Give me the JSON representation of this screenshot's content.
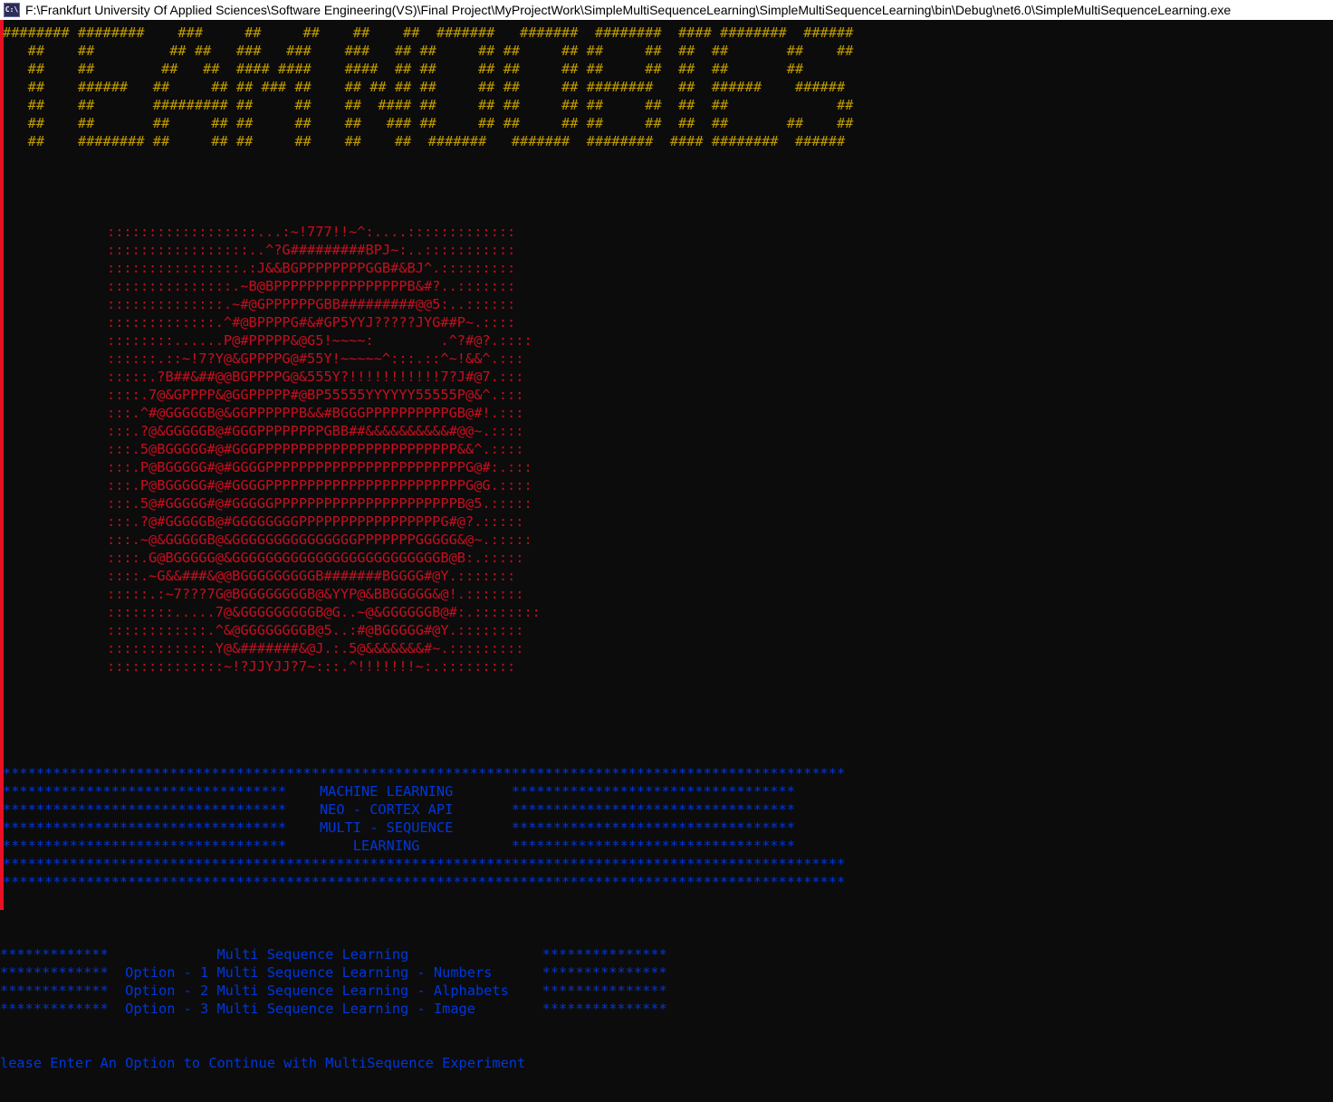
{
  "window": {
    "title": "F:\\Frankfurt University Of Applied Sciences\\Software Engineering(VS)\\Final Project\\MyProjectWork\\SimpleMultiSequenceLearning\\SimpleMultiSequenceLearning\\bin\\Debug\\net6.0\\SimpleMultiSequenceLearning.exe",
    "icon": "console-app-icon",
    "icon_glyph": "C:\\"
  },
  "colors": {
    "background": "#0c0c0c",
    "banner": "#c19c00",
    "art": "#c50f1f",
    "ml_box": "#0037da",
    "menu": "#0037da",
    "prompt": "#0037da",
    "red_bar": "#e81123"
  },
  "console": {
    "banner": "######## ########    ###     ##     ##    ##    ##  #######   #######  ########  #### ########  ######\n   ##    ##         ## ##   ###   ###    ###   ## ##     ## ##     ## ##     ##  ##  ##       ##    ##\n   ##    ##        ##   ##  #### ####    ####  ## ##     ## ##     ## ##     ##  ##  ##       ##\n   ##    ######   ##     ## ## ### ##    ## ## ## ##     ## ##     ## ########   ##  ######    ######\n   ##    ##       ######### ##     ##    ##  #### ##     ## ##     ## ##     ##  ##  ##             ##\n   ##    ##       ##     ## ##     ##    ##   ### ##     ## ##     ## ##     ##  ##  ##       ##    ##\n   ##    ######## ##     ## ##     ##    ##    ##  #######   #######  ########  #### ########  ######",
    "art": "::::::::::::::::::...:~!777!!~^:....:::::::::::::\n:::::::::::::::::..^?G#########BPJ~:..:::::::::::\n::::::::::::::::.:J&&BGPPPPPPPPGGB#&BJ^.:::::::::\n:::::::::::::::.~B@BPPPPPPPPPPPPPPPPB&#?..:::::::\n::::::::::::::.~#@GPPPPPPGBB#########@@5:..::::::\n:::::::::::::.^#@BPPPPG#&#GP5YYJ?????JYG##P~.::::\n::::::::......P@#PPPPP&@G5!~~~~:        .^?#@?.::::\n::::::.::~!7?Y@&GPPPPG@#55Y!~~~~~^:::.::^~!&&^.:::\n:::::.?B##&##@@BGPPPPG@&555Y?!!!!!!!!!!!7?J#@7.:::\n::::.7@&GPPPP&@GGPPPPP#@BP55555YYYYYY55555P@&^.:::\n:::.^#@GGGGGB@&GGPPPPPPB&&#BGGGPPPPPPPPPPGB@#!.:::\n:::.?@&GGGGGB@#GGGPPPPPPPPGBB##&&&&&&&&&&#@@~.::::\n:::.5@BGGGGG#@#GGGPPPPPPPPPPPPPPPPPPPPPPPP&&^.::::\n:::.P@BGGGGG#@#GGGGPPPPPPPPPPPPPPPPPPPPPPPPG@#:.:::\n:::.P@BGGGGG#@#GGGGPPPPPPPPPPPPPPPPPPPPPPPPG@G.::::\n:::.5@#GGGGG#@#GGGGGPPPPPPPPPPPPPPPPPPPPPPB@5.:::::\n:::.?@#GGGGGB@#GGGGGGGGPPPPPPPPPPPPPPPPPG#@?.:::::\n:::.~@&GGGGGB@&GGGGGGGGGGGGGGGPPPPPPPGGGGG&@~.:::::\n::::.G@BGGGGG@&GGGGGGGGGGGGGGGGGGGGGGGGGB@B:.:::::\n::::.~G&&###&@@BGGGGGGGGGB#######BGGGG#@Y.:::::::\n:::::.:~7???7G@BGGGGGGGGB@&YYP@&BBGGGGG&@!.:::::::\n::::::::.....7@&GGGGGGGGGB@G..~@&GGGGGGB@#:.::::::::\n::::::::::::.^&@GGGGGGGGB@5..:#@BGGGGG#@Y.::::::::\n::::::::::::.Y@&#######&@J.:.5@&&&&&&&#~.:::::::::\n::::::::::::::~!?JJYJJ?7~:::.^!!!!!!!~:.:::::::::",
    "ml_box": "*****************************************************************************************************\n**********************************    MACHINE LEARNING       **********************************\n**********************************    NEO - CORTEX API       **********************************\n**********************************    MULTI - SEQUENCE       **********************************\n**********************************        LEARNING           **********************************\n*****************************************************************************************************\n*****************************************************************************************************",
    "menu": "*************             Multi Sequence Learning                ***************\n*************  Option - 1 Multi Sequence Learning - Numbers      ***************\n*************  Option - 2 Multi Sequence Learning - Alphabets    ***************\n*************  Option - 3 Multi Sequence Learning - Image        ***************",
    "prompt": "lease Enter An Option to Continue with MultiSequence Experiment"
  }
}
